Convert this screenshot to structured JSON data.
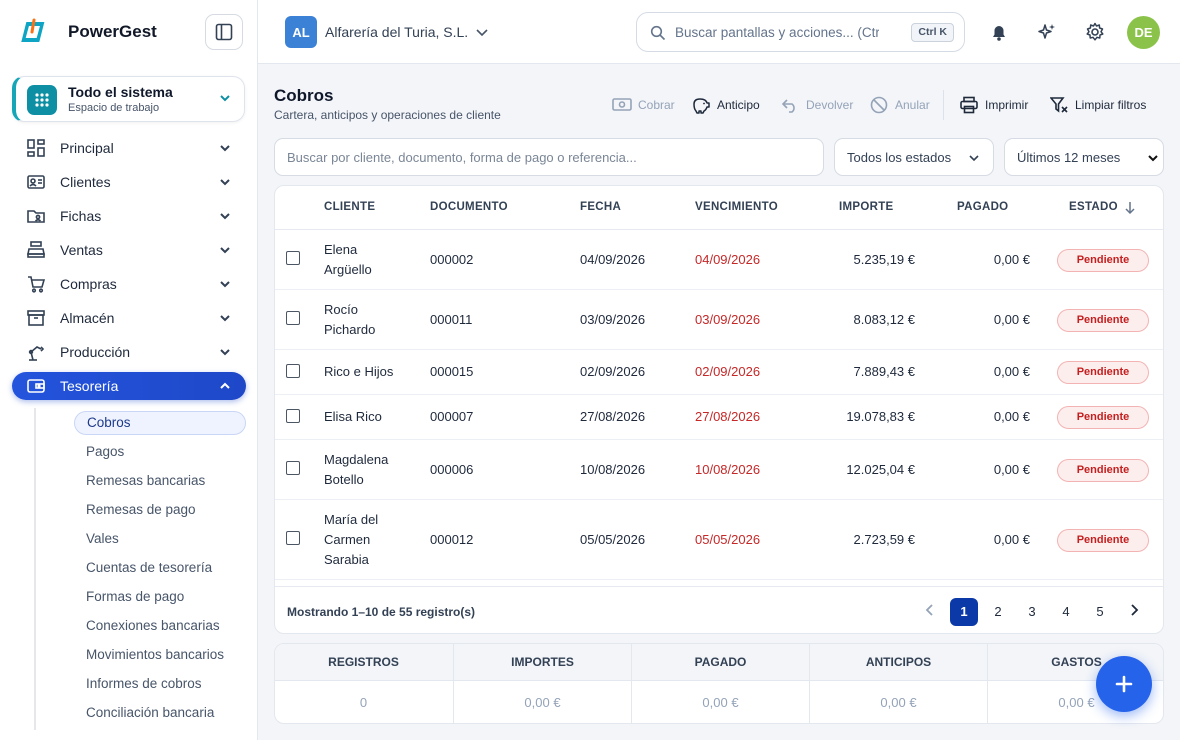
{
  "app": {
    "name": "PowerGest"
  },
  "workspace": {
    "title": "Todo el sistema",
    "subtitle": "Espacio de trabajo"
  },
  "nav": {
    "items": [
      {
        "label": "Principal",
        "icon": "dashboard-icon"
      },
      {
        "label": "Clientes",
        "icon": "contact-card-icon"
      },
      {
        "label": "Fichas",
        "icon": "folder-user-icon"
      },
      {
        "label": "Ventas",
        "icon": "cash-register-icon"
      },
      {
        "label": "Compras",
        "icon": "cart-icon"
      },
      {
        "label": "Almacén",
        "icon": "archive-box-icon"
      },
      {
        "label": "Producción",
        "icon": "robot-arm-icon"
      },
      {
        "label": "Tesorería",
        "icon": "wallet-icon"
      }
    ],
    "subitems": [
      "Cobros",
      "Pagos",
      "Remesas bancarias",
      "Remesas de pago",
      "Vales",
      "Cuentas de tesorería",
      "Formas de pago",
      "Conexiones bancarias",
      "Movimientos bancarios",
      "Informes de cobros",
      "Conciliación bancaria"
    ]
  },
  "topbar": {
    "company_initials": "AL",
    "company_name": "Alfarería del Turia, S.L.",
    "search_placeholder": "Buscar pantallas y acciones... (Ctrl+K)",
    "search_shortcut": "Ctrl K",
    "user_initials": "DE"
  },
  "page": {
    "title": "Cobros",
    "subtitle": "Cartera, anticipos y operaciones de cliente",
    "actions": {
      "cobrar": "Cobrar",
      "anticipo": "Anticipo",
      "devolver": "Devolver",
      "anular": "Anular",
      "imprimir": "Imprimir",
      "limpiar": "Limpiar filtros"
    }
  },
  "filters": {
    "search_placeholder": "Buscar por cliente, documento, forma de pago o referencia...",
    "status": "Todos los estados",
    "period": "Últimos 12 meses"
  },
  "table": {
    "headers": {
      "cliente": "CLIENTE",
      "documento": "DOCUMENTO",
      "fecha": "FECHA",
      "vencimiento": "VENCIMIENTO",
      "importe": "IMPORTE",
      "pagado": "PAGADO",
      "estado": "ESTADO"
    },
    "rows": [
      {
        "cliente": [
          "Elena",
          "Argüello"
        ],
        "documento": "000002",
        "fecha": "04/09/2026",
        "vencimiento": "04/09/2026",
        "importe": "5.235,19 €",
        "pagado": "0,00 €",
        "estado": "Pendiente"
      },
      {
        "cliente": [
          "Rocío",
          "Pichardo"
        ],
        "documento": "000011",
        "fecha": "03/09/2026",
        "vencimiento": "03/09/2026",
        "importe": "8.083,12 €",
        "pagado": "0,00 €",
        "estado": "Pendiente"
      },
      {
        "cliente": [
          "Rico e Hijos"
        ],
        "documento": "000015",
        "fecha": "02/09/2026",
        "vencimiento": "02/09/2026",
        "importe": "7.889,43 €",
        "pagado": "0,00 €",
        "estado": "Pendiente"
      },
      {
        "cliente": [
          "Elisa Rico"
        ],
        "documento": "000007",
        "fecha": "27/08/2026",
        "vencimiento": "27/08/2026",
        "importe": "19.078,83 €",
        "pagado": "0,00 €",
        "estado": "Pendiente"
      },
      {
        "cliente": [
          "Magdalena",
          "Botello"
        ],
        "documento": "000006",
        "fecha": "10/08/2026",
        "vencimiento": "10/08/2026",
        "importe": "12.025,04 €",
        "pagado": "0,00 €",
        "estado": "Pendiente"
      },
      {
        "cliente": [
          "María del",
          "Carmen",
          "Sarabia"
        ],
        "documento": "000012",
        "fecha": "05/05/2026",
        "vencimiento": "05/05/2026",
        "importe": "2.723,59 €",
        "pagado": "0,00 €",
        "estado": "Pendiente"
      }
    ],
    "footer": "Mostrando 1–10 de 55 registro(s)",
    "pages": [
      "1",
      "2",
      "3",
      "4",
      "5"
    ],
    "current_page": "1"
  },
  "totals": {
    "labels": [
      "REGISTROS",
      "IMPORTES",
      "PAGADO",
      "ANTICIPOS",
      "GASTOS"
    ],
    "values": [
      "0",
      "0,00 €",
      "0,00 €",
      "0,00 €",
      "0,00 €"
    ]
  },
  "colors": {
    "accent": "#1f4fd6",
    "due": "#c62828",
    "badge_bg": "#fdeeee",
    "badge_text": "#c41f1f",
    "avatar": "#8bc34a",
    "workspace": "#0f8fa3"
  }
}
